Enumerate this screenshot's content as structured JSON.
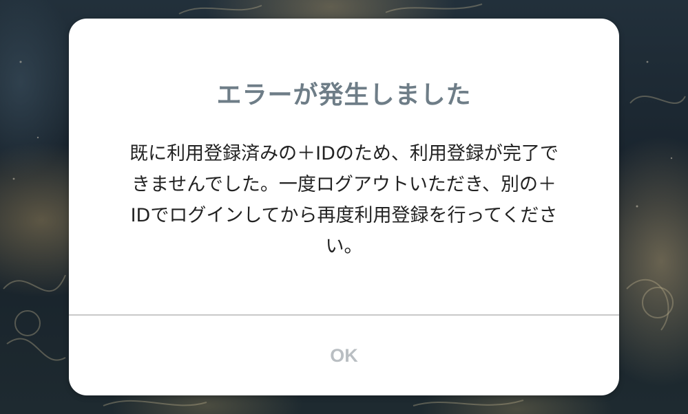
{
  "dialog": {
    "title": "エラーが発生しました",
    "message_lines": [
      "既に利用登録済みの＋IDのため、利用登録が完了で",
      "きませんでした。一度ログアウトいただき、別の＋",
      "IDでログインしてから再度利用登録を行ってくださ",
      "い。"
    ],
    "ok_label": "OK"
  },
  "colors": {
    "title": "#6e7d87",
    "message": "#222222",
    "ok_label": "#b9bec2",
    "divider": "#c8c8c8",
    "dialog_background": "#ffffff"
  }
}
